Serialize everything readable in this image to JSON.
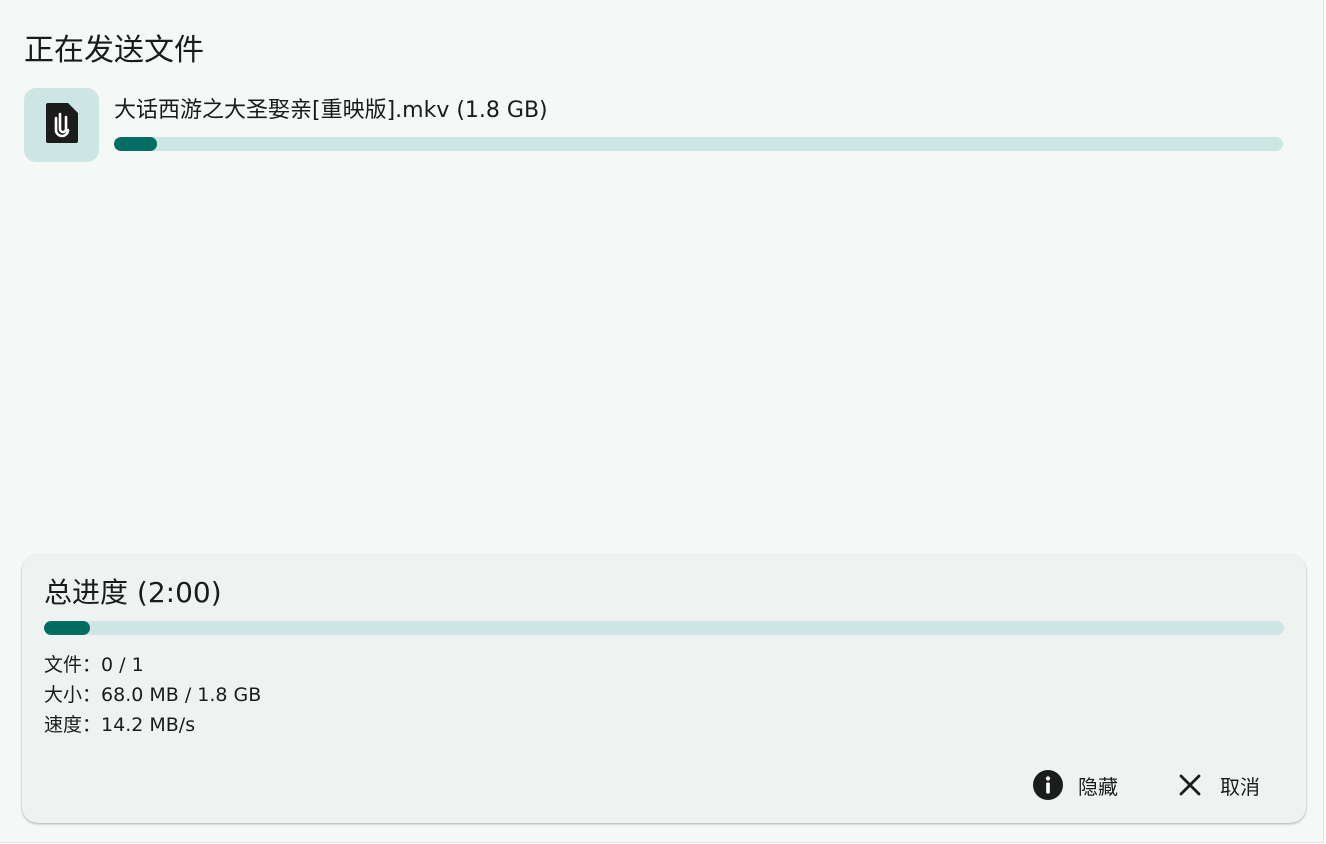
{
  "dialog": {
    "title": "正在发送文件"
  },
  "file": {
    "name": "大话西游之大圣娶亲[重映版].mkv (1.8 GB)",
    "icon": "attach-file-icon",
    "progress_percent": 3.7
  },
  "summary": {
    "title": "总进度 (2:00)",
    "progress_percent": 3.7,
    "files_label": "文件：",
    "files_value": "0 / 1",
    "size_label": "大小：",
    "size_value": "68.0 MB / 1.8 GB",
    "speed_label": "速度：",
    "speed_value": "14.2 MB/s"
  },
  "actions": {
    "hide_label": "隐藏",
    "hide_icon": "info-icon",
    "cancel_label": "取消",
    "cancel_icon": "close-icon"
  },
  "colors": {
    "accent": "#006c62",
    "track": "#cde6e3",
    "background": "#f4f9f8",
    "card": "#eef3f2"
  }
}
